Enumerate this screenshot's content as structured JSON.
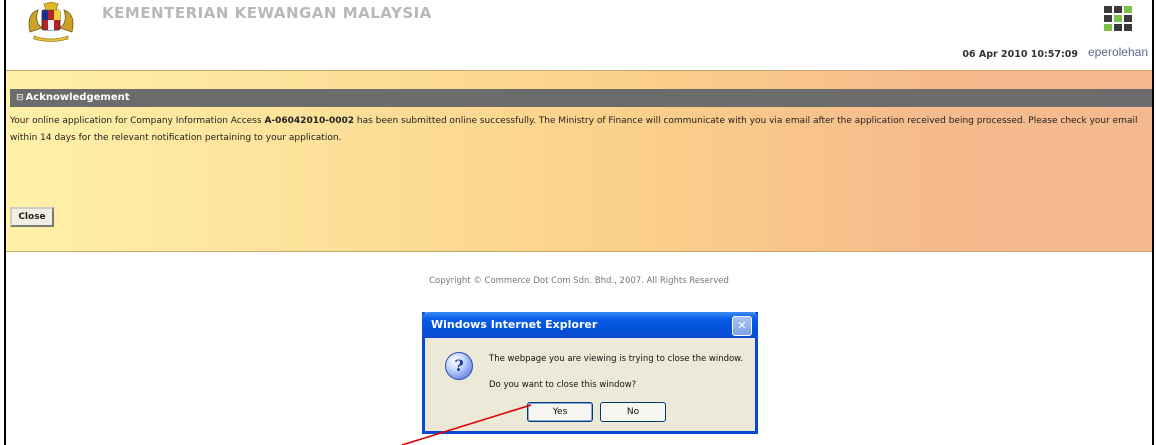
{
  "header": {
    "ministry_name": "KEMENTERIAN KEWANGAN MALAYSIA",
    "datetime": "06 Apr 2010 10:57:09",
    "brand": "eperolehan"
  },
  "acknowledgement": {
    "title": "Acknowledgement",
    "message_pre": "Your online application for Company Information Access ",
    "application_ref": "A-06042010-0002",
    "message_post": " has been submitted online successfully. The Ministry of Finance will communicate with you via email after the application received being processed. Please check your email within 14 days for the relevant notification pertaining to your application.",
    "close_label": "Close"
  },
  "footer": {
    "copyright": "Copyright © Commerce Dot Com Sdn. Bhd., 2007. All Rights Reserved"
  },
  "dialog": {
    "title": "Windows Internet Explorer",
    "line1": "The webpage you are viewing is trying to close the window.",
    "line2": "Do you want to close this window?",
    "yes_label": "Yes",
    "no_label": "No"
  },
  "colors": {
    "ack_bar": "#6c6c6c",
    "panel_start": "#fff1a8",
    "panel_end": "#f4b98e",
    "dialog_titlebar": "#0a5ee8",
    "pointer_line": "#e00000"
  }
}
